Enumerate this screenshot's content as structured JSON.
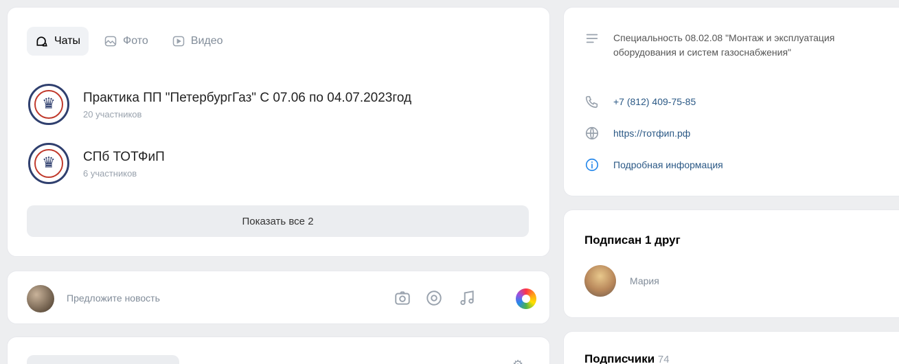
{
  "tabs": [
    {
      "label": "Чаты",
      "icon": "chat-icon",
      "active": true
    },
    {
      "label": "Фото",
      "icon": "photo-icon",
      "active": false
    },
    {
      "label": "Видео",
      "icon": "video-icon",
      "active": false
    }
  ],
  "chats": [
    {
      "title": "Практика ПП \"ПетербургГаз\" С 07.06 по 04.07.2023год",
      "members": "20 участников"
    },
    {
      "title": "СПб ТОТФиП",
      "members": "6 участников"
    }
  ],
  "show_all_label": "Показать все 2",
  "suggest_post": {
    "placeholder": "Предложите новость",
    "tools": [
      "camera-icon",
      "clip-icon",
      "music-icon",
      "color-circle-icon"
    ]
  },
  "info": {
    "description": "Специальность 08.02.08 \"Монтаж и эксплуатация оборудования и систем газоснабжения\"",
    "phone": "+7 (812) 409-75-85",
    "website": "https://тотфип.рф",
    "more_info": "Подробная информация"
  },
  "friends": {
    "heading": "Подписан 1 друг",
    "items": [
      {
        "name": "Мария"
      }
    ]
  },
  "subscribers": {
    "heading": "Подписчики",
    "count": "74"
  },
  "colors": {
    "link": "#2a5885",
    "page_bg": "#edeef0",
    "button_bg": "#ebedf0"
  }
}
